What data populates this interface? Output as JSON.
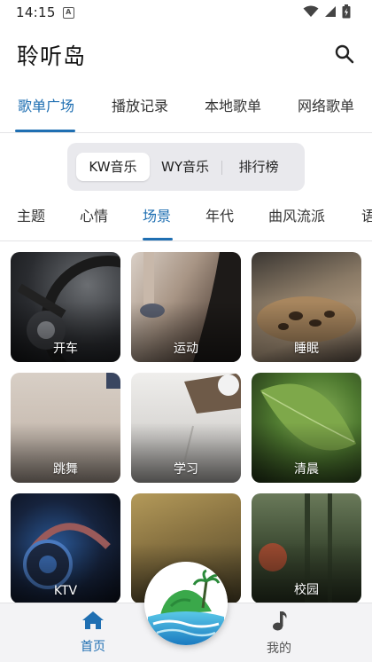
{
  "status_bar": {
    "time": "14:15",
    "notification_icon": "A",
    "icons": [
      "wifi-icon",
      "signal-icon",
      "battery-icon"
    ]
  },
  "app_bar": {
    "title": "聆听岛",
    "search_icon": "search-icon"
  },
  "main_tabs": [
    {
      "label": "歌单广场",
      "active": true
    },
    {
      "label": "播放记录",
      "active": false
    },
    {
      "label": "本地歌单",
      "active": false
    },
    {
      "label": "网络歌单",
      "active": false
    }
  ],
  "source_switch": [
    {
      "label": "KW音乐",
      "active": true
    },
    {
      "label": "WY音乐",
      "active": false
    },
    {
      "label": "排行榜",
      "active": false
    }
  ],
  "category_tabs": [
    {
      "label": "主题",
      "active": false
    },
    {
      "label": "心情",
      "active": false
    },
    {
      "label": "场景",
      "active": true
    },
    {
      "label": "年代",
      "active": false
    },
    {
      "label": "曲风流派",
      "active": false
    },
    {
      "label": "语",
      "active": false
    }
  ],
  "scene_cards": [
    {
      "label": "开车"
    },
    {
      "label": "运动"
    },
    {
      "label": "睡眠"
    },
    {
      "label": "跳舞"
    },
    {
      "label": "学习"
    },
    {
      "label": "清晨"
    },
    {
      "label": "KTV"
    },
    {
      "label": ""
    },
    {
      "label": "校园"
    }
  ],
  "bottom_nav": [
    {
      "label": "首页",
      "icon": "home-icon",
      "active": true
    },
    {
      "label": "我的",
      "icon": "music-note-icon",
      "active": false
    }
  ],
  "colors": {
    "accent": "#1f6fb2",
    "background": "#ffffff",
    "nav_background": "#f3f3f5"
  }
}
